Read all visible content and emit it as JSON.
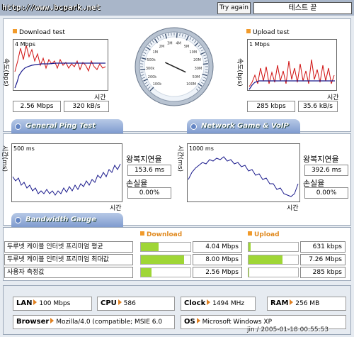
{
  "header": {
    "url": "http://www.bcpark.net",
    "try_again": "Try again",
    "status": "테스트 끝"
  },
  "download": {
    "title": "Download test",
    "ylabel": "속도(bps)",
    "scale": "4 Mbps",
    "xlabel": "시간",
    "mbps": "2.56 Mbps",
    "kbs": "320 kB/s"
  },
  "upload": {
    "title": "Upload test",
    "ylabel": "속도(bps)",
    "scale": "1 Mbps",
    "xlabel": "시간",
    "kbps": "285 kbps",
    "kbs": "35.6 kB/s"
  },
  "gauge": {
    "ticks": [
      "100k",
      "200k",
      "300k",
      "500k",
      "1M",
      "2M",
      "3M",
      "4M",
      "5M",
      "10M",
      "20M",
      "30M",
      "50M",
      "100M"
    ],
    "needle_fraction": 0.26
  },
  "tabs": {
    "ping": "General Ping Test",
    "game": "Network Game & VoIP Test",
    "bandwidth": "Bandwidth Gauge"
  },
  "ping_left": {
    "ylabel": "시간(ms)",
    "scale": "500 ms",
    "xlabel": "시간",
    "rtt_label": "왕복지연율",
    "rtt": "153.6 ms",
    "loss_label": "손실율",
    "loss": "0.00%"
  },
  "ping_right": {
    "ylabel": "시간(ms)",
    "scale": "1000 ms",
    "xlabel": "시간",
    "rtt_label": "왕복지연율",
    "rtt": "392.6 ms",
    "loss_label": "손실율",
    "loss": "0.00%"
  },
  "bandwidth": {
    "download_header": "Download",
    "upload_header": "Upload",
    "rows": [
      {
        "label": "두루넷 케이블 인터넷 프리미엄 평균",
        "down": "4.04 Mbps",
        "down_frac": 0.36,
        "up": "631 kbps",
        "up_frac": 0.04
      },
      {
        "label": "두루넷 케이블 인터넷 프리미엄 최대값",
        "down": "8.00 Mbps",
        "down_frac": 0.87,
        "up": "7.26 Mbps",
        "up_frac": 0.68
      },
      {
        "label": "사용자 측정값",
        "down": "2.56 Mbps",
        "down_frac": 0.22,
        "up": "285 kbps",
        "up_frac": 0.02
      }
    ]
  },
  "system": {
    "lan_label": "LAN",
    "lan": "100 Mbps",
    "cpu_label": "CPU",
    "cpu": "586",
    "clock_label": "Clock",
    "clock": "1494 MHz",
    "ram_label": "RAM",
    "ram": "256 MB",
    "browser_label": "Browser",
    "browser": "Mozilla/4.0 (compatible; MSIE 6.0",
    "os_label": "OS",
    "os": "Microsoft Windows XP",
    "timestamp": "jin / 2005-01-18 00:55:53"
  },
  "colors": {
    "accent_orange": "#f19a2a",
    "bar_green": "#9fd636",
    "series_red": "#d01010",
    "series_blue": "#1a1a8c"
  }
}
